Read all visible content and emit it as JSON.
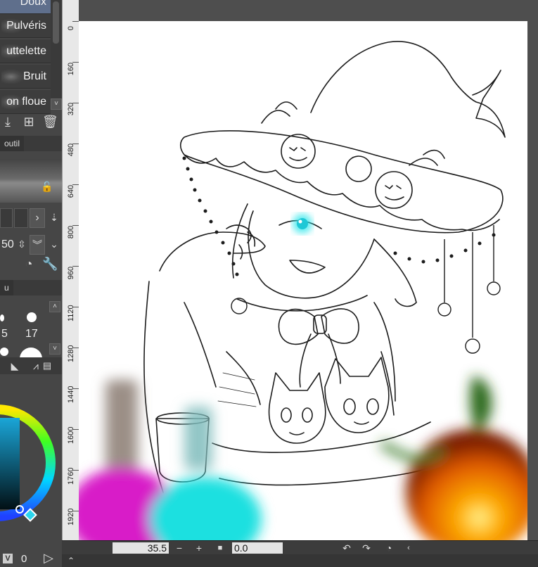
{
  "brushes": {
    "items": [
      {
        "label": "Doux",
        "selected": true
      },
      {
        "label": "Pulvéris",
        "selected": false
      },
      {
        "label": "uttelette",
        "selected": false
      },
      {
        "label": "Bruit",
        "selected": false
      },
      {
        "label": "on floue",
        "selected": false
      }
    ]
  },
  "tool_property": {
    "tab_label": "outil"
  },
  "brush_size": {
    "tab_label": "u",
    "value": "50",
    "sizes": [
      "5",
      "17"
    ]
  },
  "color": {
    "v_label": "V",
    "value": "0"
  },
  "ruler": {
    "ticks": [
      "0",
      "160",
      "320",
      "480",
      "640",
      "800",
      "960",
      "1120",
      "1280",
      "1440",
      "1600",
      "1760",
      "1920"
    ]
  },
  "navigator": {
    "zoom": "35.5",
    "angle": "0.0"
  },
  "colors": {
    "panel": "#464646",
    "accent": "#5f6f8c",
    "canvas_bg": "#4e4e4e",
    "ruler": "#e8e8e8"
  }
}
